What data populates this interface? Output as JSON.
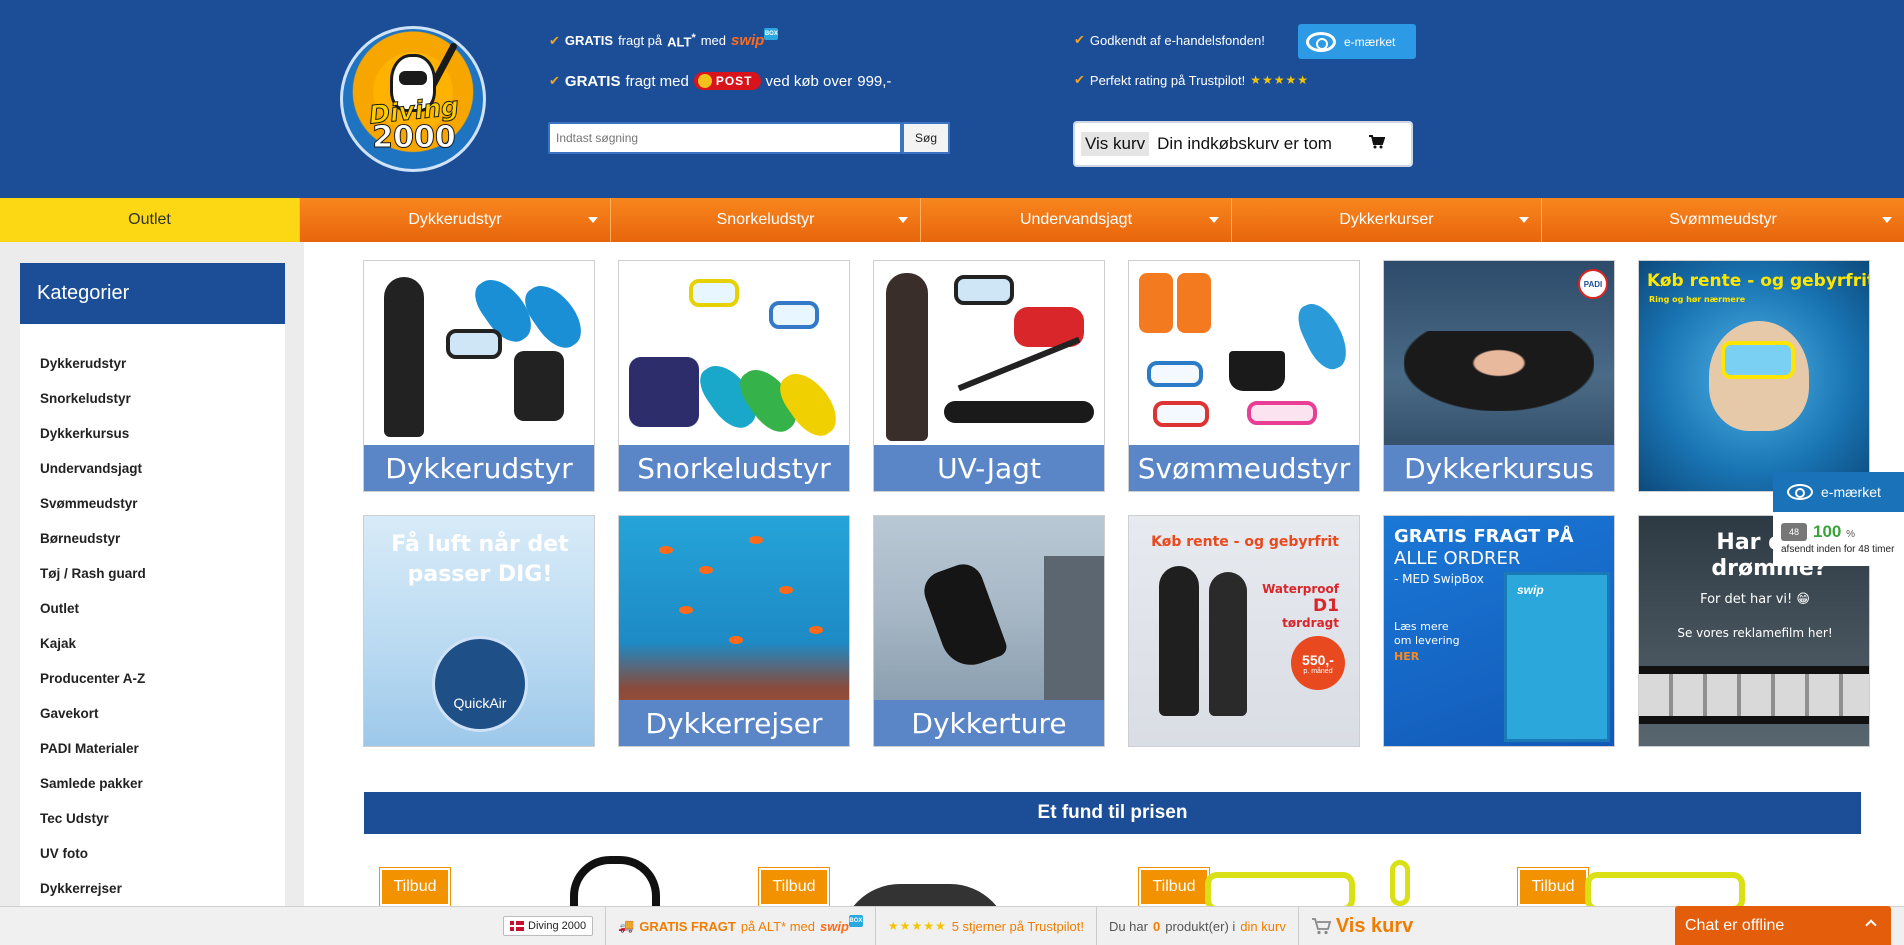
{
  "header": {
    "logo_top": "Diving",
    "logo_bottom": "2000",
    "usp_free_shipping": {
      "gratis": "GRATIS",
      "text": "fragt på",
      "alt": "ALT",
      "star": "*",
      "med": "med",
      "swip": "swip",
      "box": "BOX"
    },
    "usp_post": {
      "gratis": "GRATIS",
      "text1": "fragt med",
      "post": "POST",
      "text2": "ved køb over",
      "amount": "999,-"
    },
    "usp_approved": "Godkendt af e-handelsfonden!",
    "usp_rating": "Perfekt rating på Trustpilot!",
    "rating_stars": "★★★★★",
    "emaerket_label": "e-mærket",
    "search_placeholder": "Indtast søgning",
    "search_button": "Søg",
    "cart_view_label": "Vis kurv",
    "cart_status": "Din indkøbskurv er tom"
  },
  "nav": [
    {
      "label": "Outlet"
    },
    {
      "label": "Dykkerudstyr"
    },
    {
      "label": "Snorkeludstyr"
    },
    {
      "label": "Undervandsjagt"
    },
    {
      "label": "Dykkerkurser"
    },
    {
      "label": "Svømmeudstyr"
    }
  ],
  "sidebar": {
    "title": "Kategorier",
    "items": [
      "Dykkerudstyr",
      "Snorkeludstyr",
      "Dykkerkursus",
      "Undervandsjagt",
      "Svømmeudstyr",
      "Børneudstyr",
      "Tøj / Rash guard",
      "Outlet",
      "Kajak",
      "Producenter A-Z",
      "Gavekort",
      "PADI Materialer",
      "Samlede pakker",
      "Tec Udstyr",
      "UV foto",
      "Dykkerrejser"
    ]
  },
  "tiles": {
    "row1": [
      "Dykkerudstyr",
      "Snorkeludstyr",
      "UV-Jagt",
      "Svømmeudstyr",
      "Dykkerkursus"
    ],
    "padi": "PADI",
    "finance_title": "Køb rente - og gebyrfrit",
    "finance_sub": "Ring og hør nærmere",
    "quickair_headline": "Få luft når det passer DIG!",
    "quickair_brand": "QuickAir",
    "reef_label": "Dykkerrejser",
    "sea_label": "Dykkerture",
    "drysuit_title": "Køb rente - og gebyrfrit",
    "drysuit_product": "Waterproof",
    "drysuit_model": "D1",
    "drysuit_type": "tørdragt",
    "drysuit_price": "550,-",
    "drysuit_price_unit": "p. måned",
    "swipbox_line1": "GRATIS FRAGT PÅ",
    "swipbox_line2": "ALLE ORDRER",
    "swipbox_line3": "- MED SwipBox",
    "swipbox_line4": "Læs mere",
    "swipbox_line5": "om levering",
    "swipbox_here": "HER",
    "swipbox_brand": "swip",
    "film_line1": "Har du v",
    "film_line2": "drømme?",
    "film_line3": "For det har vi! 😁",
    "film_line4": "Se vores reklamefilm her!"
  },
  "promo": {
    "title": "Et fund til prisen",
    "badge": "Tilbud"
  },
  "float": {
    "emaerket": "e-mærket",
    "hours_badge": "48",
    "percent": "100",
    "percent_sign": "%",
    "note": "afsendt inden for 48 timer"
  },
  "bottom_bar": {
    "shop_name": "Diving 2000",
    "shipping_strong": "GRATIS FRAGT",
    "shipping_rest": "på ALT* med",
    "swip": "swip",
    "rating_stars": "★★★★★",
    "rating_text": "5 stjerner på Trustpilot!",
    "basket_prefix": "Du har",
    "basket_count": "0",
    "basket_mid": "produkt(er) i",
    "basket_link": "din kurv",
    "cart_button": "Vis kurv",
    "chat": "Chat er offline"
  },
  "colors": {
    "brand_blue": "#1c4e97",
    "nav_orange": "#f07d00",
    "outlet_yellow": "#fbd813",
    "tile_label_blue": "#5a86c8"
  }
}
